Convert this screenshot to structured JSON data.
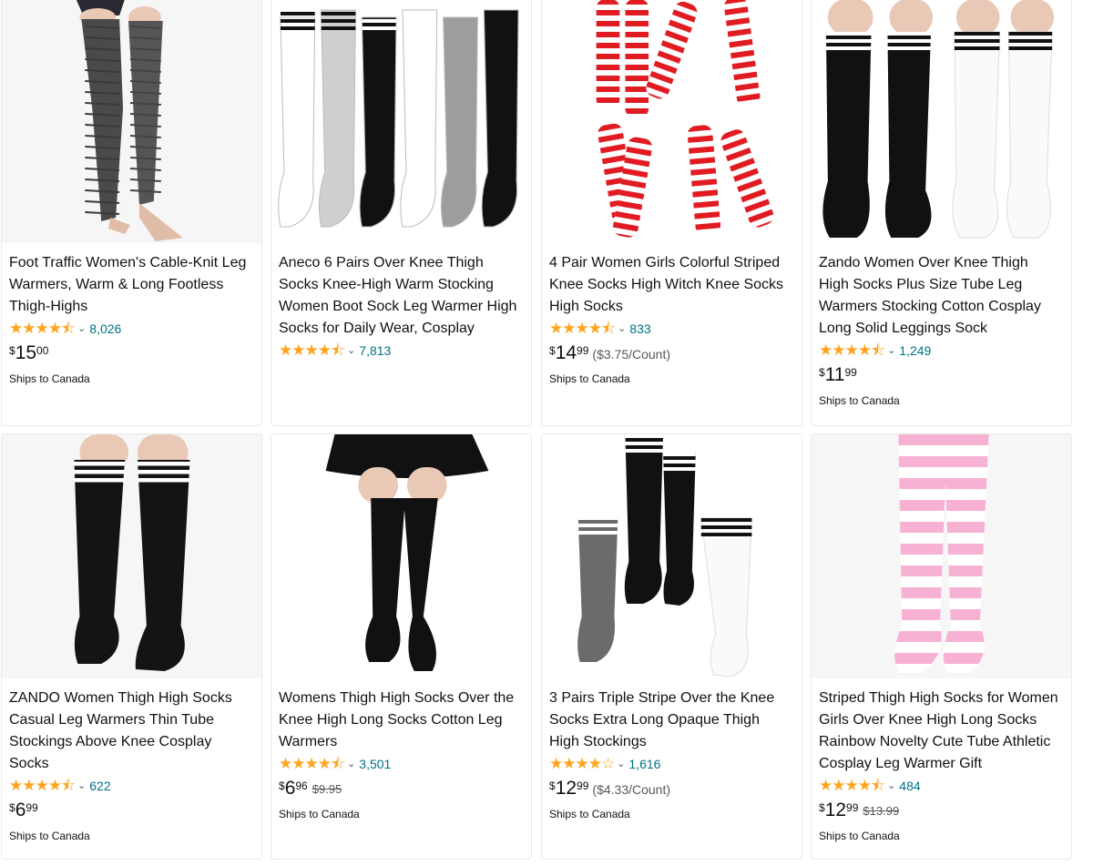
{
  "colors": {
    "star": "#ffa41c",
    "link": "#007185",
    "text": "#0f1111",
    "muted": "#565959",
    "border": "#e7e9ec"
  },
  "products": [
    {
      "title": "Foot Traffic Women's Cable-Knit Leg Warmers, Warm & Long Footless Thigh-Highs",
      "stars": 4.5,
      "review_count": "8,026",
      "price": {
        "currency": "$",
        "whole": "15",
        "fraction": "00"
      },
      "unit_price": "",
      "list_price": "",
      "shipping": "Ships to Canada",
      "image_icon": "cable-knit-leg-warmers-image"
    },
    {
      "title": "Aneco 6 Pairs Over Knee Thigh Socks Knee-High Warm Stocking Women Boot Sock Leg Warmer High Socks for Daily Wear, Cosplay",
      "stars": 4.5,
      "review_count": "7,813",
      "price": null,
      "unit_price": "",
      "list_price": "",
      "shipping": "",
      "image_icon": "six-pairs-thigh-socks-image"
    },
    {
      "title": "4 Pair Women Girls Colorful Striped Knee Socks High Witch Knee Socks High Socks",
      "stars": 4.5,
      "review_count": "833",
      "price": {
        "currency": "$",
        "whole": "14",
        "fraction": "99"
      },
      "unit_price": "($3.75/Count)",
      "list_price": "",
      "shipping": "Ships to Canada",
      "image_icon": "red-striped-knee-socks-image"
    },
    {
      "title": "Zando Women Over Knee Thigh High Socks Plus Size Tube Leg Warmers Stocking Cotton Cosplay Long Solid Leggings Sock",
      "stars": 4.5,
      "review_count": "1,249",
      "price": {
        "currency": "$",
        "whole": "11",
        "fraction": "99"
      },
      "unit_price": "",
      "list_price": "",
      "shipping": "Ships to Canada",
      "image_icon": "black-white-thigh-socks-image"
    },
    {
      "title": "ZANDO Women Thigh High Socks Casual Leg Warmers Thin Tube Stockings Above Knee Cosplay Socks",
      "stars": 4.5,
      "review_count": "622",
      "price": {
        "currency": "$",
        "whole": "6",
        "fraction": "99"
      },
      "unit_price": "",
      "list_price": "",
      "shipping": "Ships to Canada",
      "image_icon": "black-striped-thigh-socks-image"
    },
    {
      "title": "Womens Thigh High Socks Over the Knee High Long Socks Cotton Leg Warmers",
      "stars": 4.5,
      "review_count": "3,501",
      "price": {
        "currency": "$",
        "whole": "6",
        "fraction": "96"
      },
      "unit_price": "",
      "list_price": "$9.95",
      "shipping": "Ships to Canada",
      "image_icon": "black-thigh-socks-skirt-image"
    },
    {
      "title": "3 Pairs Triple Stripe Over the Knee Socks Extra Long Opaque Thigh High Stockings",
      "stars": 4.0,
      "review_count": "1,616",
      "price": {
        "currency": "$",
        "whole": "12",
        "fraction": "99"
      },
      "unit_price": "($4.33/Count)",
      "list_price": "",
      "shipping": "Ships to Canada",
      "image_icon": "triple-stripe-socks-image"
    },
    {
      "title": "Striped Thigh High Socks for Women Girls Over Knee High Long Socks Rainbow Novelty Cute Tube Athletic Cosplay Leg Warmer Gift",
      "stars": 4.5,
      "review_count": "484",
      "price": {
        "currency": "$",
        "whole": "12",
        "fraction": "99"
      },
      "unit_price": "",
      "list_price": "$13.99",
      "shipping": "Ships to Canada",
      "image_icon": "pink-striped-socks-image"
    }
  ]
}
